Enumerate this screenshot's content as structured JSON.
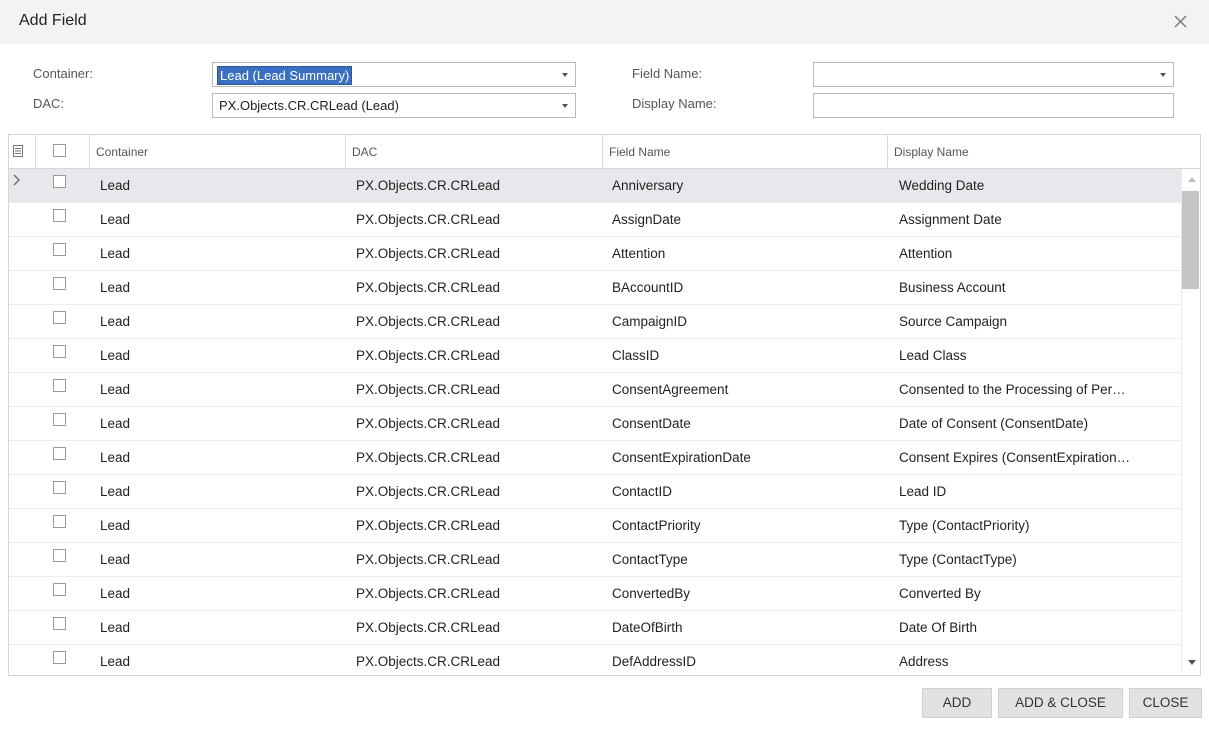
{
  "dialog": {
    "title": "Add Field"
  },
  "form": {
    "container_label": "Container:",
    "container_value": "Lead (Lead Summary)",
    "dac_label": "DAC:",
    "dac_value": "PX.Objects.CR.CRLead (Lead)",
    "field_name_label": "Field Name:",
    "field_name_value": "",
    "display_name_label": "Display Name:",
    "display_name_value": ""
  },
  "grid": {
    "columns": [
      "Container",
      "DAC",
      "Field Name",
      "Display Name"
    ],
    "rows": [
      {
        "container": "Lead",
        "dac": "PX.Objects.CR.CRLead",
        "field": "Anniversary",
        "display": "Wedding Date"
      },
      {
        "container": "Lead",
        "dac": "PX.Objects.CR.CRLead",
        "field": "AssignDate",
        "display": "Assignment Date"
      },
      {
        "container": "Lead",
        "dac": "PX.Objects.CR.CRLead",
        "field": "Attention",
        "display": "Attention"
      },
      {
        "container": "Lead",
        "dac": "PX.Objects.CR.CRLead",
        "field": "BAccountID",
        "display": "Business Account"
      },
      {
        "container": "Lead",
        "dac": "PX.Objects.CR.CRLead",
        "field": "CampaignID",
        "display": "Source Campaign"
      },
      {
        "container": "Lead",
        "dac": "PX.Objects.CR.CRLead",
        "field": "ClassID",
        "display": "Lead Class"
      },
      {
        "container": "Lead",
        "dac": "PX.Objects.CR.CRLead",
        "field": "ConsentAgreement",
        "display": "Consented to the Processing of Per…"
      },
      {
        "container": "Lead",
        "dac": "PX.Objects.CR.CRLead",
        "field": "ConsentDate",
        "display": "Date of Consent (ConsentDate)"
      },
      {
        "container": "Lead",
        "dac": "PX.Objects.CR.CRLead",
        "field": "ConsentExpirationDate",
        "display": "Consent Expires (ConsentExpiration…"
      },
      {
        "container": "Lead",
        "dac": "PX.Objects.CR.CRLead",
        "field": "ContactID",
        "display": "Lead ID"
      },
      {
        "container": "Lead",
        "dac": "PX.Objects.CR.CRLead",
        "field": "ContactPriority",
        "display": "Type (ContactPriority)"
      },
      {
        "container": "Lead",
        "dac": "PX.Objects.CR.CRLead",
        "field": "ContactType",
        "display": "Type (ContactType)"
      },
      {
        "container": "Lead",
        "dac": "PX.Objects.CR.CRLead",
        "field": "ConvertedBy",
        "display": "Converted By"
      },
      {
        "container": "Lead",
        "dac": "PX.Objects.CR.CRLead",
        "field": "DateOfBirth",
        "display": "Date Of Birth"
      },
      {
        "container": "Lead",
        "dac": "PX.Objects.CR.CRLead",
        "field": "DefAddressID",
        "display": "Address"
      }
    ]
  },
  "buttons": {
    "add": "ADD",
    "add_close": "ADD & CLOSE",
    "close": "CLOSE"
  }
}
